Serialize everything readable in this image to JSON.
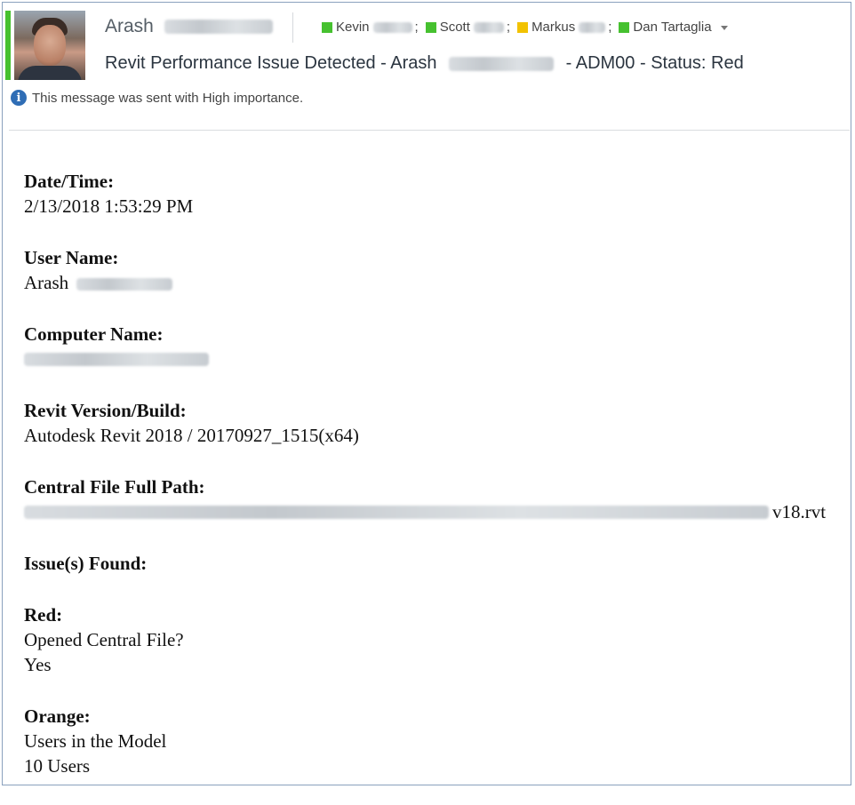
{
  "header": {
    "sender_first_name": "Arash",
    "recipients": [
      {
        "name": "Kevin",
        "status_color": "#46c12f",
        "separator": ";"
      },
      {
        "name": "Scott",
        "status_color": "#46c12f",
        "separator": ";"
      },
      {
        "name": "Markus",
        "status_color": "#f2c200",
        "separator": ";"
      },
      {
        "name": "Dan Tartaglia",
        "status_color": "#46c12f",
        "separator": ""
      }
    ],
    "subject_prefix": "Revit Performance Issue Detected - Arash",
    "subject_suffix": "- ADM00 - Status: Red",
    "importance_text": "This message was sent with High importance.",
    "presence_color": "#46c12f"
  },
  "body": {
    "datetime_label": "Date/Time:",
    "datetime_value": "2/13/2018 1:53:29 PM",
    "username_label": "User Name:",
    "username_value": "Arash",
    "computer_label": "Computer Name:",
    "revit_label": "Revit Version/Build:",
    "revit_value": "Autodesk Revit 2018 / 20170927_1515(x64)",
    "path_label": "Central File Full Path:",
    "path_suffix": "v18.rvt",
    "issues_label": "Issue(s) Found:",
    "red_label": "Red:",
    "red_question": "Opened Central File?",
    "red_answer": "Yes",
    "orange_label": "Orange:",
    "orange_item": "Users in the Model",
    "orange_value": "10 Users"
  }
}
